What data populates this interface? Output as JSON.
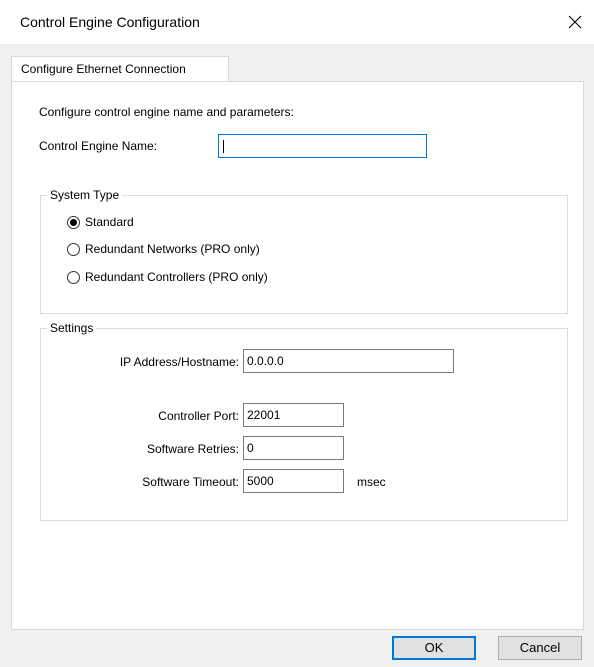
{
  "window": {
    "title": "Control Engine Configuration"
  },
  "tabs": [
    {
      "label": "Configure Ethernet Connection",
      "active": true
    }
  ],
  "intro": "Configure control engine name and parameters:",
  "engine_name": {
    "label": "Control Engine Name:",
    "value": ""
  },
  "system_type": {
    "legend": "System Type",
    "options": [
      {
        "label": "Standard",
        "selected": true
      },
      {
        "label": "Redundant Networks (PRO only)",
        "selected": false
      },
      {
        "label": "Redundant Controllers (PRO only)",
        "selected": false
      }
    ]
  },
  "settings": {
    "legend": "Settings",
    "ip": {
      "label": "IP Address/Hostname:",
      "value": "0.0.0.0"
    },
    "port": {
      "label": "Controller Port:",
      "value": "22001"
    },
    "retries": {
      "label": "Software Retries:",
      "value": "0"
    },
    "timeout": {
      "label": "Software Timeout:",
      "value": "5000",
      "unit": "msec"
    }
  },
  "buttons": {
    "ok": "OK",
    "cancel": "Cancel"
  },
  "colors": {
    "accent": "#0078d7",
    "panel": "#ffffff",
    "dialog_bg": "#f0f0f0"
  },
  "icons": {
    "close": "close-icon"
  }
}
